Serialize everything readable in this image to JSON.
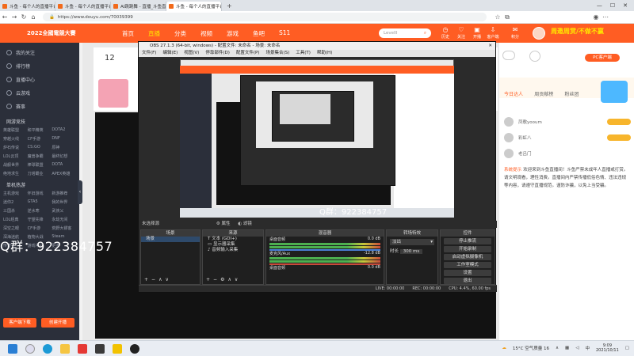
{
  "browser": {
    "tabs": [
      {
        "label": "斗鱼 - 每个人的直播平台"
      },
      {
        "label": "斗鱼 - 每个人的直播平台"
      },
      {
        "label": "AI跳跳舞 - 直播_斗鱼直播"
      },
      {
        "label": "斗鱼 - 每个人的直播平台"
      }
    ],
    "window_controls": [
      "—",
      "☐",
      "✕"
    ],
    "url": "https://www.douyu.com/70039399"
  },
  "site": {
    "logo_text": "2022全國電競大賽",
    "nav": [
      "首页",
      "直播",
      "分类",
      "视频",
      "游戏",
      "鱼吧",
      "S11"
    ],
    "active_nav": "直播",
    "search_placeholder": "Levelll",
    "header_icons": [
      "历史",
      "关注",
      "开播",
      "客户端",
      "积分"
    ],
    "header_banner": "周邀周赏/不做不赢"
  },
  "sidebar": {
    "items": [
      "我的关注",
      "排行榜",
      "直播中心",
      "云游戏",
      "赛事"
    ],
    "section1_title": "网游竞技",
    "section1_games": [
      "英雄联盟",
      "和平精英",
      "DOTA2",
      "穿越火线",
      "CF手游",
      "DNF",
      "炉石传说",
      "CS:GO",
      "原神",
      "LOL云顶",
      "魔兽争霸",
      "最终幻想",
      "战舰世界",
      "棒球联盟",
      "DOTA",
      "绝地求生",
      "刀塔霸业",
      "APEX英雄"
    ],
    "section2_title": "单机热游",
    "section2_games": [
      "主机游戏",
      "怀旧游戏",
      "新游推荐",
      "迷你2",
      "GTA5",
      "我的世界",
      "三国杀",
      "逆水寒",
      "武侠乂",
      "LOL经典",
      "守望先锋",
      "永劫无间",
      "深空之眼",
      "CF手游",
      "荒野大镖客",
      "深海迷航",
      "植物大战",
      "Steam",
      "传奇",
      "游戏中心",
      "更多"
    ],
    "bottom_buttons": [
      "客户端下载",
      "创建开播"
    ]
  },
  "room": {
    "stream_number": "12",
    "overlay_qq_large": "Q群：922384757",
    "overlay_qq_small": "Q群：922384757"
  },
  "right_panel": {
    "tabs": [
      "今日达人",
      "周贡献榜",
      "粉丝团"
    ],
    "pc_button": "PC客户端",
    "ranking": [
      {
        "name": "凤歌yooum"
      },
      {
        "name": "彩虹八"
      },
      {
        "name": "老吕门"
      }
    ],
    "chat_label": "系统提示",
    "chat_text": "欢迎来到斗鱼直播间！斗鱼严禁未成年人直播或打赏。请文明观看，理性消费。直播间内严禁传播低俗色情、违法违规等内容，请遵守直播规范。谨防诈骗，以免上当受骗。"
  },
  "obs": {
    "title": "OBS 27.1.3 (64-bit, windows) - 配置文件: 未命名 - 场景: 未命名",
    "menu": [
      "文件(F)",
      "编辑(E)",
      "视图(V)",
      "停靠部件(D)",
      "配置文件(P)",
      "场景集合(S)",
      "工具(T)",
      "帮助(H)"
    ],
    "scene_label": "未选择源",
    "props_button": "属性",
    "filters_button": "滤镜",
    "panels": {
      "scenes": "场景",
      "sources": "来源",
      "mixer": "混音器",
      "transitions": "转场特效",
      "controls": "控件"
    },
    "scenes_list": [
      "场景"
    ],
    "sources_list": [
      "文本 (GDI+)",
      "显示器采集",
      "音频输入采集"
    ],
    "mixer_tracks": [
      {
        "name": "桌面音频",
        "db": "0.0 dB"
      },
      {
        "name": "麦克风/Aux",
        "db": "-12.8 dB"
      },
      {
        "name": "桌面音频",
        "db": "0.0 dB"
      }
    ],
    "transition_type": "淡出",
    "transition_duration_label": "时长",
    "transition_duration": "300 ms",
    "controls": [
      "停止推流",
      "开始录制",
      "启动虚拟摄像机",
      "工作室模式",
      "设置",
      "退出"
    ],
    "status": [
      "LIVE: 00:00:00",
      "REC: 00:00:00",
      "CPU: 4.4%, 60.00 fps"
    ]
  },
  "taskbar": {
    "weather": "15°C 空气质量 16",
    "time": "9:09",
    "date": "2021/10/11",
    "lang": "中"
  },
  "colors": {
    "brand": "#ff5d23",
    "sidebar": "#2b2f3a",
    "obs_bg": "#2b2b2b"
  }
}
